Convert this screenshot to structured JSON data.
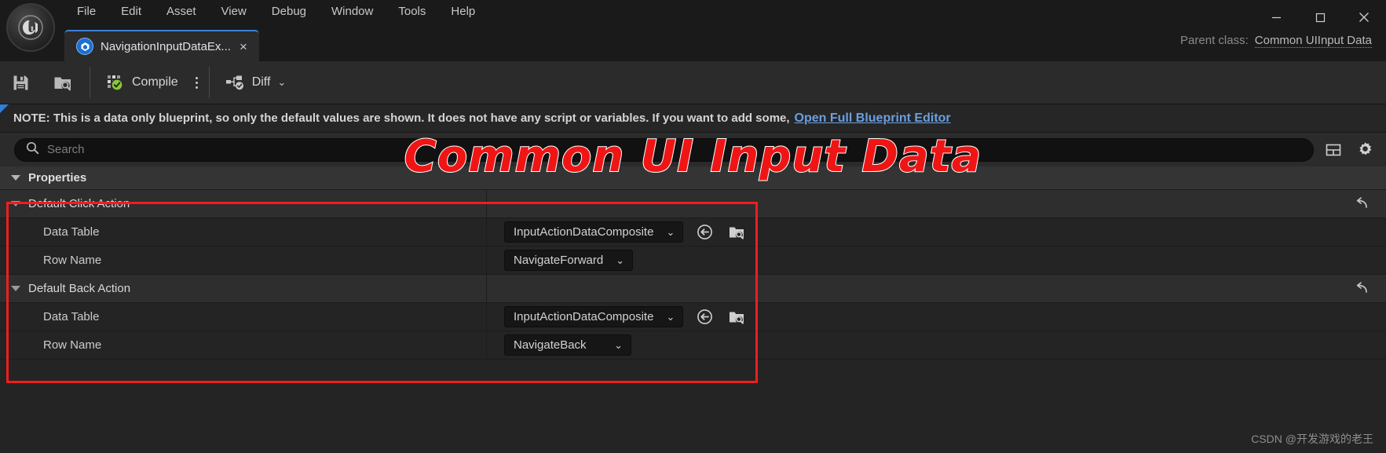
{
  "window": {
    "logo_alt": "unreal-engine-logo",
    "minimize_label": "—",
    "maximize_label": "□",
    "close_label": "✕"
  },
  "menu": {
    "items": [
      {
        "label": "File"
      },
      {
        "label": "Edit"
      },
      {
        "label": "Asset"
      },
      {
        "label": "View"
      },
      {
        "label": "Debug"
      },
      {
        "label": "Window"
      },
      {
        "label": "Tools"
      },
      {
        "label": "Help"
      }
    ]
  },
  "tab": {
    "icon": "blueprint-icon",
    "label": "NavigationInputDataEx...",
    "close_label": "×"
  },
  "parent_class": {
    "label": "Parent class:",
    "value": "Common UIInput Data"
  },
  "toolbar": {
    "save_icon": "save-icon",
    "browse_icon": "browse-content-icon",
    "compile_label": "Compile",
    "compile_icon": "compile-success-icon",
    "kebab_icon": "compile-options-icon",
    "diff_label": "Diff",
    "diff_icon": "diff-icon",
    "diff_chevron": "⌄"
  },
  "note": {
    "text": "NOTE: This is a data only blueprint, so only the default values are shown.  It does not have any script or variables.  If you want to add some,",
    "link": "Open Full Blueprint Editor"
  },
  "search": {
    "placeholder": "Search",
    "icon": "search-icon",
    "column_icon": "column-settings-icon",
    "settings_icon": "gear-icon"
  },
  "properties": {
    "section_title": "Properties",
    "reset_icon": "reset-to-default-icon",
    "groups": [
      {
        "name": "Default Click Action",
        "has_reset": true,
        "rows": [
          {
            "name": "Data Table",
            "value": "InputActionDataComposite",
            "combo_chevron": "⌄",
            "use_selected_icon": "use-selected-asset-icon",
            "browse_icon": "browse-asset-icon",
            "style": "wide"
          },
          {
            "name": "Row Name",
            "value": "NavigateForward",
            "combo_chevron": "⌄",
            "style": "narrow"
          }
        ]
      },
      {
        "name": "Default Back Action",
        "has_reset": true,
        "rows": [
          {
            "name": "Data Table",
            "value": "InputActionDataComposite",
            "combo_chevron": "⌄",
            "use_selected_icon": "use-selected-asset-icon",
            "browse_icon": "browse-asset-icon",
            "style": "wide"
          },
          {
            "name": "Row Name",
            "value": "NavigateBack",
            "combo_chevron": "⌄",
            "style": "narrow"
          }
        ]
      }
    ]
  },
  "overlay": {
    "stamp_text": "Common UI Input Data",
    "stamp_color": "#f01515",
    "highlight_color": "#f21d1d",
    "watermark": "CSDN @开发游戏的老王"
  }
}
